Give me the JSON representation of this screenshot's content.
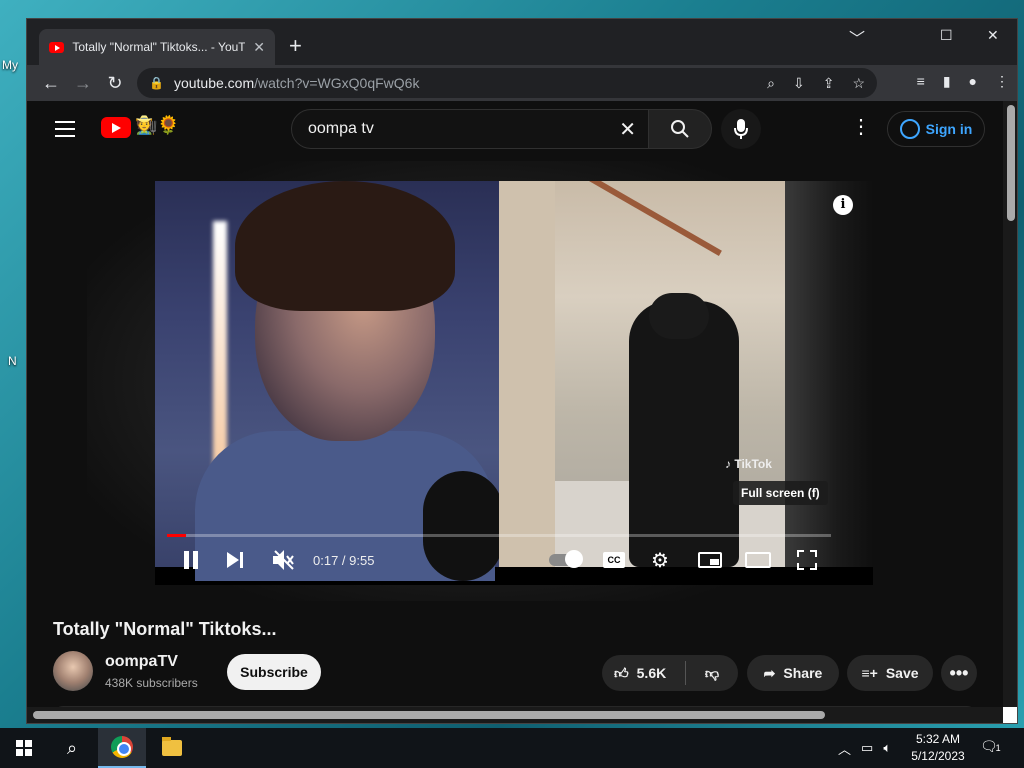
{
  "desktop": {
    "labels": [
      "My",
      "N"
    ]
  },
  "browser": {
    "tab_title": "Totally \"Normal\" Tiktoks... - YouTube",
    "tab_close": "✕",
    "new_tab": "+",
    "win_min": "﹀",
    "win_max": "☐",
    "win_close": "✕",
    "url_host": "youtube.com",
    "url_path": "/watch?v=WGxQ0qFwQ6k"
  },
  "youtube": {
    "search_value": "oompa tv",
    "sign_in": "Sign in",
    "doodle": "🧑‍🌾🌻",
    "player": {
      "tiktok_badge": "♪ TikTok",
      "tooltip": "Full screen (f)",
      "time": "0:17 / 9:55",
      "progress_fraction": 0.029,
      "cc": "CC"
    },
    "video": {
      "title": "Totally \"Normal\" Tiktoks...",
      "channel": "oompaTV",
      "subscribers": "438K subscribers",
      "subscribe": "Subscribe",
      "likes": "5.6K",
      "share": "Share",
      "save": "Save"
    }
  },
  "taskbar": {
    "time": "5:32 AM",
    "date": "5/12/2023",
    "notif_count": "1"
  }
}
